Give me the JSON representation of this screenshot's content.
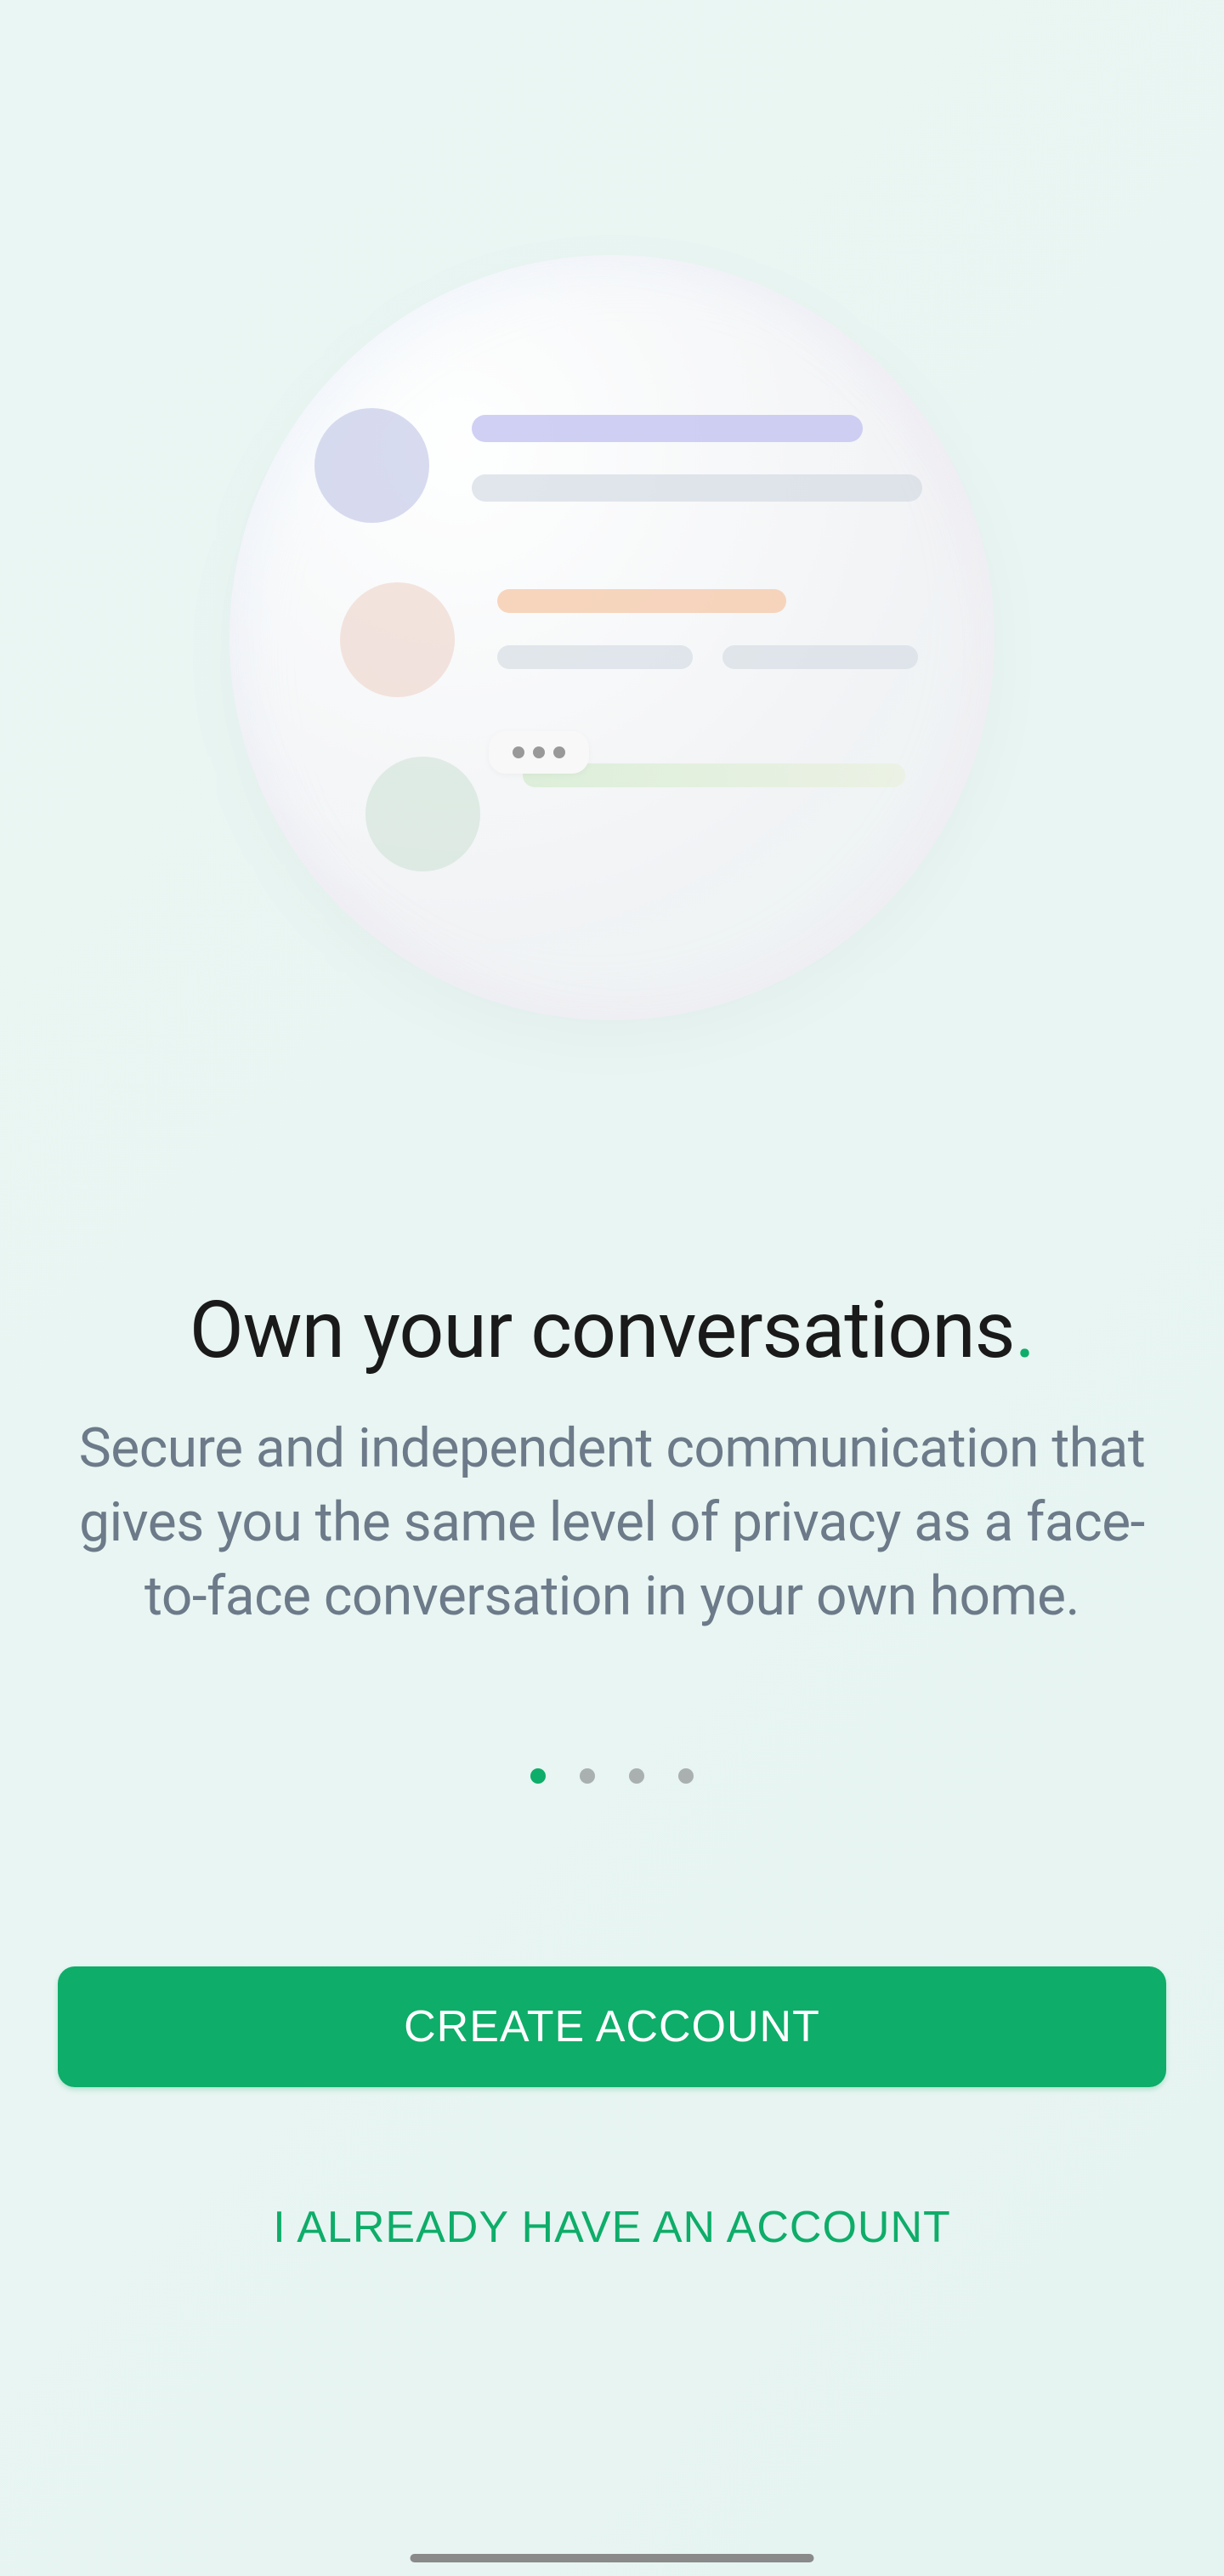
{
  "onboarding": {
    "headline": "Own your conversations",
    "headline_period": ".",
    "subheadline": "Secure and independent communication that gives you the same level of privacy as a face-to-face conversation in your own home.",
    "page_count": 4,
    "active_page": 1
  },
  "buttons": {
    "create_account": "CREATE ACCOUNT",
    "already_have_account": "I ALREADY HAVE AN ACCOUNT"
  },
  "colors": {
    "accent": "#0ead69",
    "text_primary": "#1a1a1a",
    "text_secondary": "#6c7a89"
  }
}
